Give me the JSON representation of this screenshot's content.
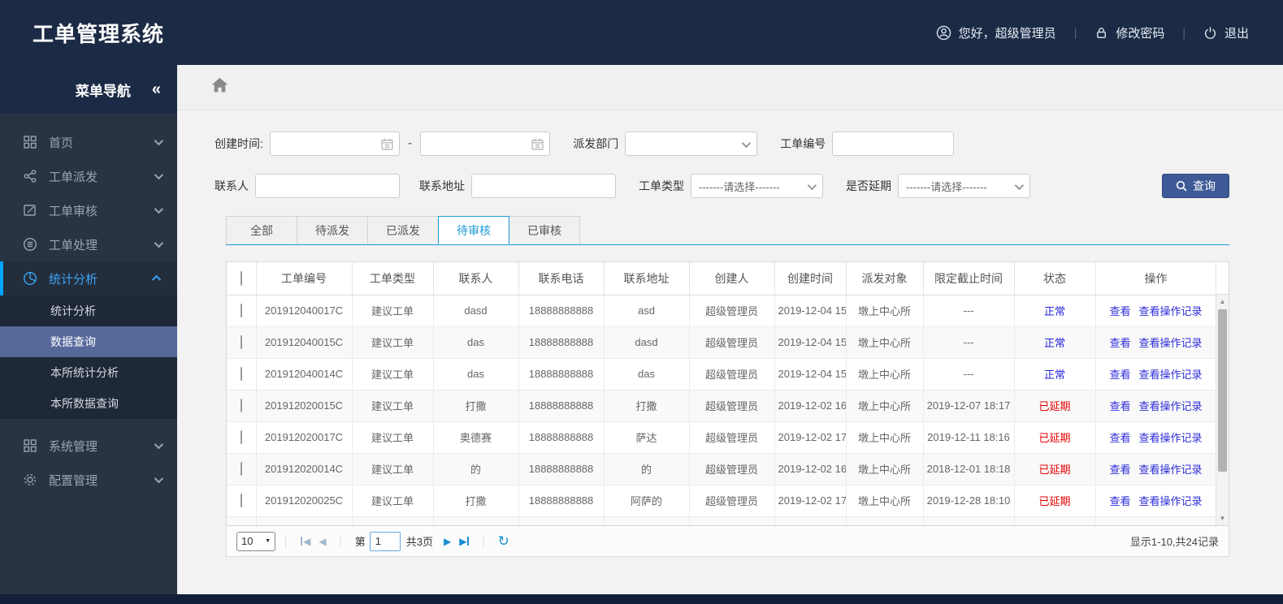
{
  "header": {
    "title": "工单管理系统",
    "greeting": "您好，超级管理员",
    "change_password": "修改密码",
    "logout": "退出"
  },
  "sidebar": {
    "title": "菜单导航",
    "items": [
      {
        "label": "首页",
        "icon": "grid-icon"
      },
      {
        "label": "工单派发",
        "icon": "share-icon"
      },
      {
        "label": "工单审核",
        "icon": "edit-icon"
      },
      {
        "label": "工单处理",
        "icon": "process-icon"
      },
      {
        "label": "统计分析",
        "icon": "pie-chart-icon",
        "active": true,
        "expanded": true
      },
      {
        "label": "系统管理",
        "icon": "grid-icon"
      },
      {
        "label": "配置管理",
        "icon": "gear-icon"
      }
    ],
    "submenu": [
      {
        "label": "统计分析"
      },
      {
        "label": "数据查询",
        "selected": true
      },
      {
        "label": "本所统计分析"
      },
      {
        "label": "本所数据查询"
      }
    ]
  },
  "filters": {
    "created_time_label": "创建时间:",
    "range_separator": "-",
    "dispatch_dept_label": "派发部门",
    "order_no_label": "工单编号",
    "contact_label": "联系人",
    "address_label": "联系地址",
    "order_type_label": "工单类型",
    "delay_label": "是否延期",
    "select_placeholder": "-------请选择-------",
    "search_button": "查询"
  },
  "tabs": [
    {
      "label": "全部"
    },
    {
      "label": "待派发"
    },
    {
      "label": "已派发"
    },
    {
      "label": "待审核",
      "active": true
    },
    {
      "label": "已审核"
    }
  ],
  "table": {
    "columns": [
      "工单编号",
      "工单类型",
      "联系人",
      "联系电话",
      "联系地址",
      "创建人",
      "创建时间",
      "派发对象",
      "限定截止时间",
      "状态",
      "操作"
    ],
    "actions": [
      "查看",
      "查看操作记录"
    ],
    "rows": [
      {
        "id": "201912040017C",
        "type": "建议工单",
        "contact": "dasd",
        "phone": "18888888888",
        "address": "asd",
        "creator": "超级管理员",
        "created": "2019-12-04 15",
        "target": "墩上中心所",
        "deadline": "---",
        "status": "正常",
        "delayed": false
      },
      {
        "id": "201912040015C",
        "type": "建议工单",
        "contact": "das",
        "phone": "18888888888",
        "address": "dasd",
        "creator": "超级管理员",
        "created": "2019-12-04 15",
        "target": "墩上中心所",
        "deadline": "---",
        "status": "正常",
        "delayed": false
      },
      {
        "id": "201912040014C",
        "type": "建议工单",
        "contact": "das",
        "phone": "18888888888",
        "address": "das",
        "creator": "超级管理员",
        "created": "2019-12-04 15",
        "target": "墩上中心所",
        "deadline": "---",
        "status": "正常",
        "delayed": false
      },
      {
        "id": "201912020015C",
        "type": "建议工单",
        "contact": "打撒",
        "phone": "18888888888",
        "address": "打撒",
        "creator": "超级管理员",
        "created": "2019-12-02 16",
        "target": "墩上中心所",
        "deadline": "2019-12-07 18:17",
        "status": "已延期",
        "delayed": true
      },
      {
        "id": "201912020017C",
        "type": "建议工单",
        "contact": "奥德赛",
        "phone": "18888888888",
        "address": "萨达",
        "creator": "超级管理员",
        "created": "2019-12-02 17",
        "target": "墩上中心所",
        "deadline": "2019-12-11 18:16",
        "status": "已延期",
        "delayed": true
      },
      {
        "id": "201912020014C",
        "type": "建议工单",
        "contact": "的",
        "phone": "18888888888",
        "address": "的",
        "creator": "超级管理员",
        "created": "2019-12-02 16",
        "target": "墩上中心所",
        "deadline": "2018-12-01 18:18",
        "status": "已延期",
        "delayed": true
      },
      {
        "id": "201912020025C",
        "type": "建议工单",
        "contact": "打撒",
        "phone": "18888888888",
        "address": "阿萨的",
        "creator": "超级管理员",
        "created": "2019-12-02 17",
        "target": "墩上中心所",
        "deadline": "2019-12-28 18:10",
        "status": "已延期",
        "delayed": true
      },
      {
        "id": "",
        "type": "",
        "contact": "",
        "phone": "",
        "address": "",
        "creator": "",
        "created": "",
        "target": "",
        "deadline": "",
        "status": "",
        "partial": true
      }
    ]
  },
  "pagination": {
    "page_size": "10",
    "page_label": "第",
    "page_value": "1",
    "total_label": "共3页",
    "summary": "显示1-10,共24记录"
  },
  "icons": {
    "collapse": "«",
    "prev": "◀",
    "next": "▶",
    "refresh": "↻",
    "up": "▲",
    "down": "▼",
    "caret": "▼"
  },
  "colors": {
    "topbar_bg": "#1c2b45",
    "sidebar_bg": "#2a3342",
    "submenu_selected_bg": "#57689b",
    "active_menu_blue": "#3ba4f5",
    "tab_accent_blue": "#1c9ad6",
    "search_button_blue": "#3d5a96",
    "link_blue": "#2d2dd8",
    "status_normal_blue": "#2424dd",
    "status_delayed_red": "#e60000"
  }
}
